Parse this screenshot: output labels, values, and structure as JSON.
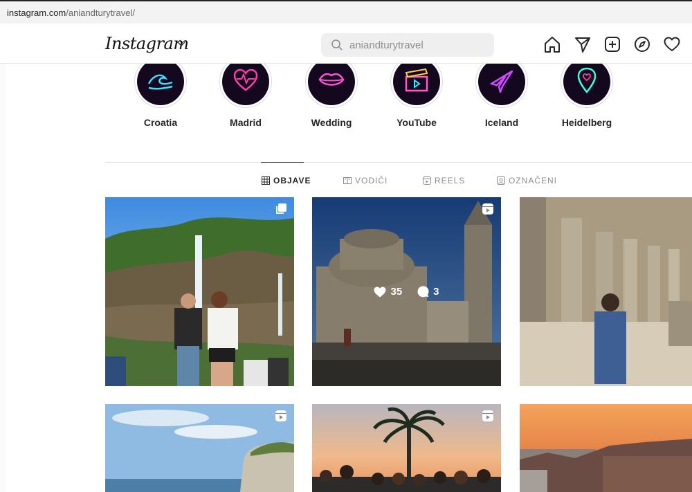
{
  "browser": {
    "url_host": "instagram.com",
    "url_path": "/aniandturytravel/"
  },
  "header": {
    "logo": "Instagram",
    "search_placeholder": "aniandturytravel",
    "nav_icons": [
      "home-icon",
      "direct-send-icon",
      "new-post-icon",
      "explore-compass-icon",
      "activity-heart-icon"
    ]
  },
  "highlights": [
    {
      "label": "Croatia",
      "icon": "wave-icon",
      "color": "#3de0ff"
    },
    {
      "label": "Madrid",
      "icon": "heartbeat-icon",
      "color": "#ff3da6"
    },
    {
      "label": "Wedding",
      "icon": "lips-icon",
      "color": "#ff4fd8"
    },
    {
      "label": "YouTube",
      "icon": "clapperboard-icon",
      "color": "#ff5cc8"
    },
    {
      "label": "Iceland",
      "icon": "airplane-icon",
      "color": "#d048ff"
    },
    {
      "label": "Heidelberg",
      "icon": "location-pin-icon",
      "color": "#3dffe0"
    }
  ],
  "tabs": [
    {
      "label": "OBJAVE",
      "icon": "grid-icon",
      "active": true
    },
    {
      "label": "VODIČI",
      "icon": "guide-icon",
      "active": false
    },
    {
      "label": "REELS",
      "icon": "reels-icon",
      "active": false
    },
    {
      "label": "OZNAČENI",
      "icon": "tagged-icon",
      "active": false
    }
  ],
  "posts": [
    {
      "type": "carousel",
      "scene": "waterfall"
    },
    {
      "type": "reel",
      "scene": "church",
      "hover": true,
      "likes": "35",
      "comments": "3"
    },
    {
      "type": "photo",
      "scene": "amphitheater"
    },
    {
      "type": "reel",
      "scene": "cliff-sea"
    },
    {
      "type": "reel",
      "scene": "palm-sunset-group"
    },
    {
      "type": "photo",
      "scene": "sunset-city"
    }
  ]
}
